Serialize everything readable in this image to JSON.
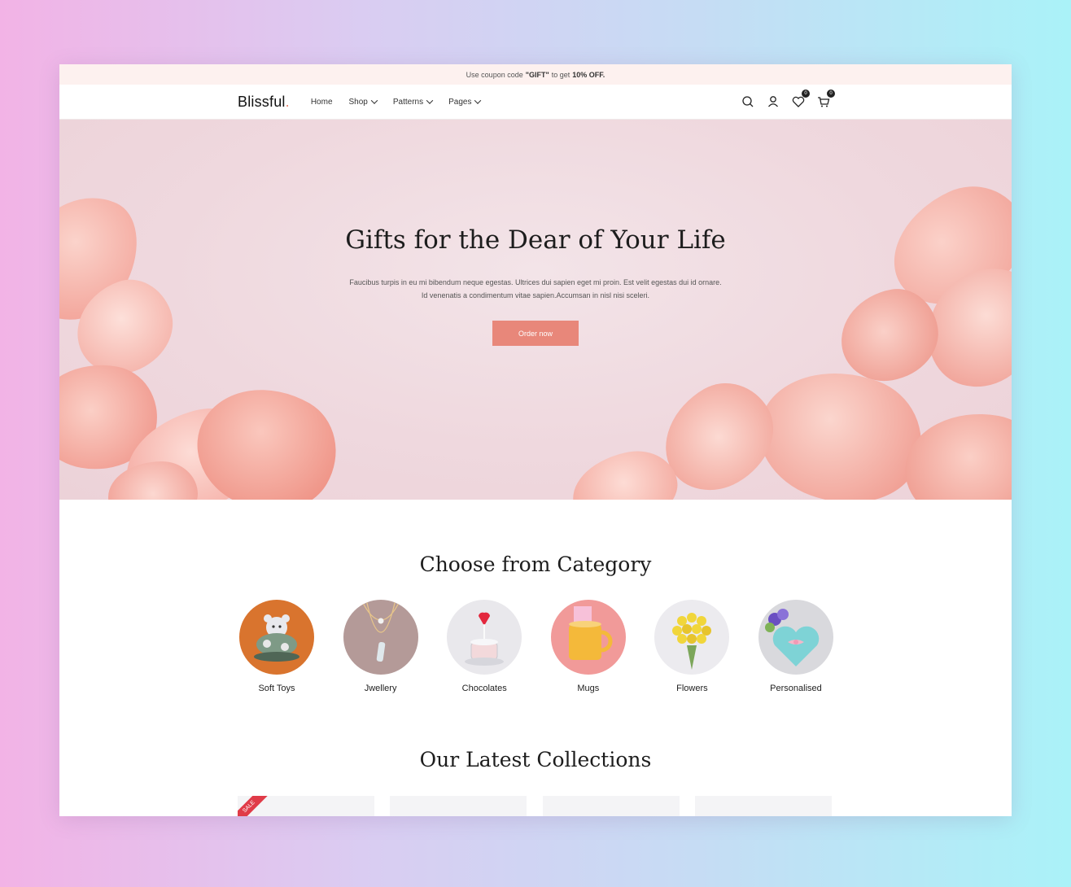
{
  "promo": {
    "text_before": "Use coupon code",
    "code": "\"GIFT\"",
    "text_mid": "to get",
    "discount": "10% OFF."
  },
  "header": {
    "logo_text": "Blissful",
    "logo_dot": ".",
    "nav": [
      {
        "label": "Home",
        "dropdown": false
      },
      {
        "label": "Shop",
        "dropdown": true
      },
      {
        "label": "Patterns",
        "dropdown": true
      },
      {
        "label": "Pages",
        "dropdown": true
      }
    ],
    "icons": [
      "search-icon",
      "user-icon",
      "heart-icon",
      "cart-icon"
    ],
    "wishlist_count": "0",
    "cart_count": "0"
  },
  "hero": {
    "title": "Gifts for the Dear of Your Life",
    "text_line1": "Faucibus turpis in eu mi bibendum neque egestas. Ultrices dui sapien eget mi proin. Est velit egestas dui id ornare.",
    "text_line2": "Id venenatis a condimentum vitae sapien.Accumsan in nisl nisi sceleri.",
    "button_label": "Order now"
  },
  "categories": {
    "title": "Choose from Category",
    "items": [
      {
        "label": "Soft Toys"
      },
      {
        "label": "Jwellery"
      },
      {
        "label": "Chocolates"
      },
      {
        "label": "Mugs"
      },
      {
        "label": "Flowers"
      },
      {
        "label": "Personalised"
      }
    ]
  },
  "latest": {
    "title": "Our Latest Collections",
    "sale_label": "SALE"
  },
  "colors": {
    "accent": "#e8877a",
    "promo_bg": "#fdf1ef",
    "sale": "#e03b48"
  }
}
